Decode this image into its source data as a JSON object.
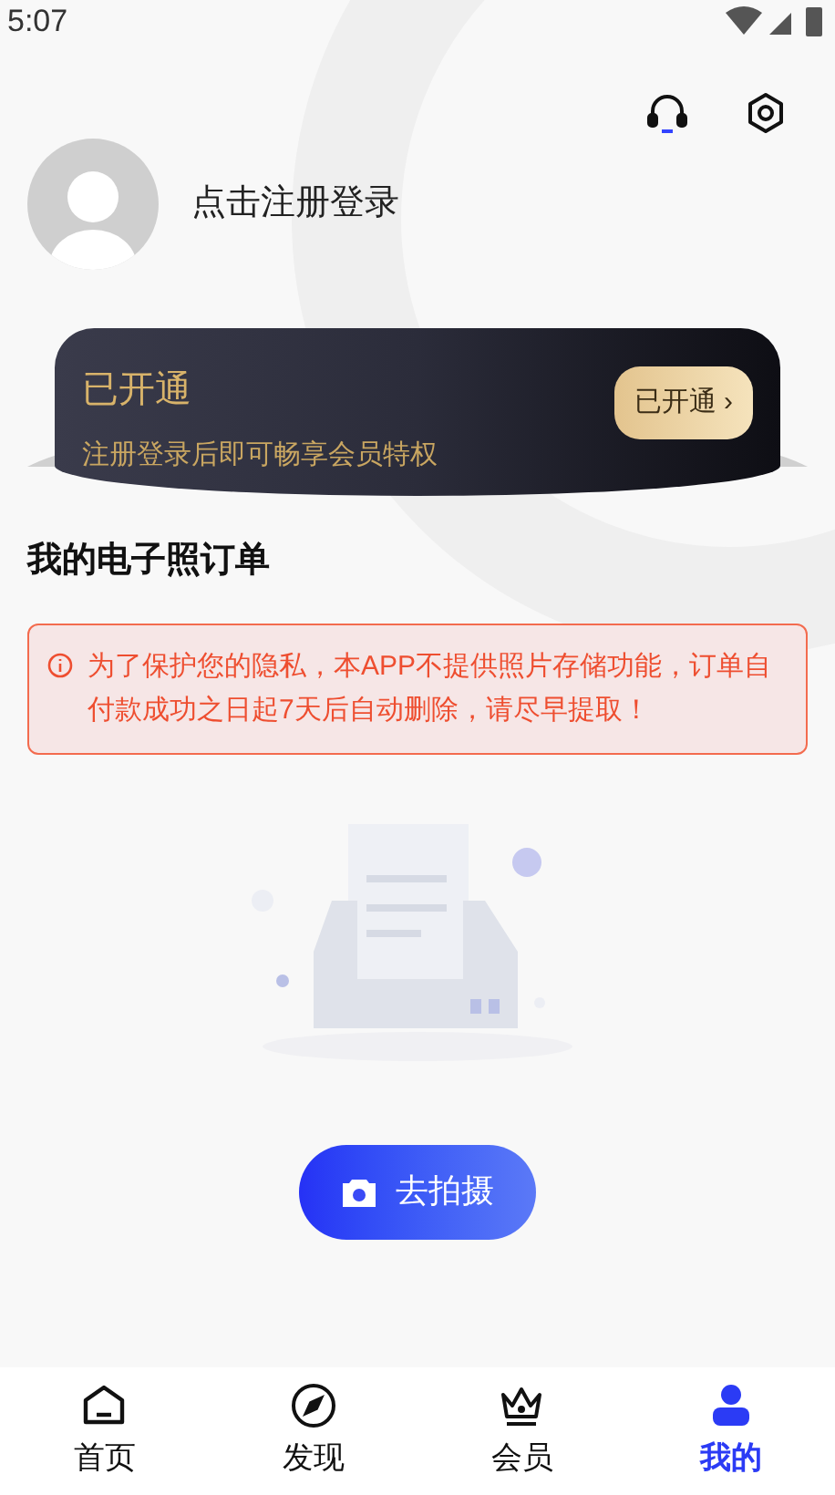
{
  "status_bar": {
    "time": "5:07"
  },
  "profile": {
    "login_text": "点击注册登录"
  },
  "vip_card": {
    "title": "已开通",
    "subtitle": "注册登录后即可畅享会员特权",
    "button": "已开通 ›"
  },
  "orders": {
    "title": "我的电子照订单",
    "notice": "为了保护您的隐私，本APP不提供照片存储功能，订单自付款成功之日起7天后自动删除，请尽早提取！",
    "action_button": "去拍摄"
  },
  "tab_bar": [
    {
      "kind": "home",
      "label": "首页",
      "selected": false
    },
    {
      "kind": "discover",
      "label": "发现",
      "selected": false
    },
    {
      "kind": "vip",
      "label": "会员",
      "selected": false
    },
    {
      "kind": "me",
      "label": "我的",
      "selected": true
    }
  ]
}
